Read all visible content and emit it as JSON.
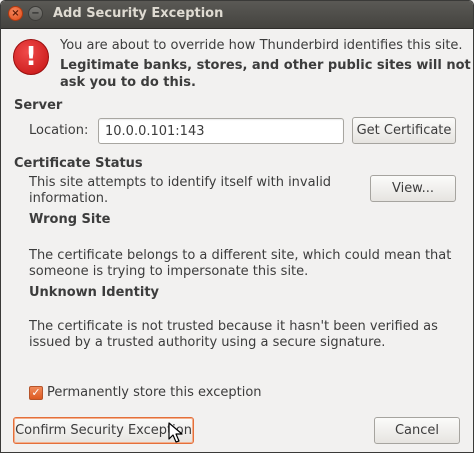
{
  "window": {
    "title": "Add Security Exception"
  },
  "warning": {
    "icon": "exclamation-icon",
    "line1": "You are about to override how Thunderbird identifies this site.",
    "line2a": "Legitimate banks, stores, and other public sites will not",
    "line2b": "ask you to do this."
  },
  "server": {
    "heading": "Server",
    "location_label": "Location:",
    "location_value": "10.0.0.101:143",
    "get_cert_label": "Get Certificate"
  },
  "cert_status": {
    "heading": "Certificate Status",
    "intro_a": "This site attempts to identify itself with invalid",
    "intro_b": "information.",
    "view_label": "View...",
    "wrong_site_heading": "Wrong Site",
    "wrong_site_a": "The certificate belongs to a different site, which could mean that",
    "wrong_site_b": "someone is trying to impersonate this site.",
    "unknown_heading": "Unknown Identity",
    "unknown_a": "The certificate is not trusted because it hasn't been verified as",
    "unknown_b": "issued by a trusted authority using a secure signature."
  },
  "permanent": {
    "label": "Permanently store this exception",
    "checked": true
  },
  "buttons": {
    "confirm": "Confirm Security Exception",
    "cancel": "Cancel"
  },
  "colors": {
    "accent": "#dd5a22",
    "titlebar": "#4a4945",
    "warning_red": "#d01a1a"
  }
}
